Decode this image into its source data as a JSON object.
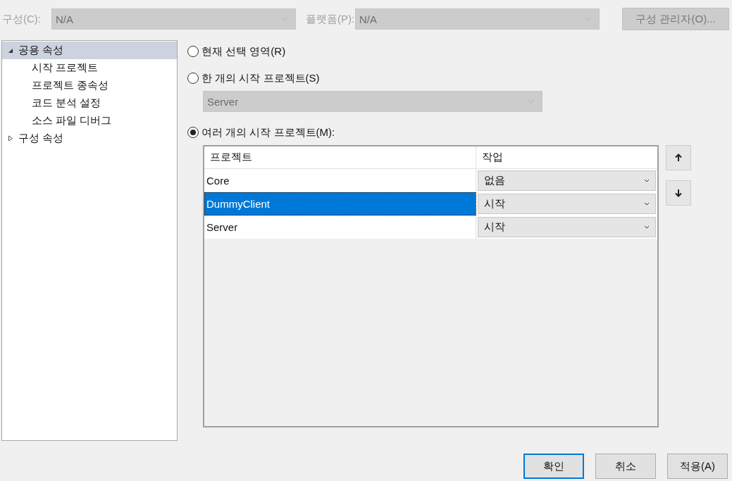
{
  "config_bar": {
    "configuration": {
      "label": "구성(C):",
      "value": "N/A",
      "disabled": true
    },
    "platform": {
      "label": "플랫폼(P):",
      "value": "N/A",
      "disabled": true
    },
    "manager_button": {
      "label": "구성 관리자(O)...",
      "disabled": true
    }
  },
  "tree": [
    {
      "label": "공용 속성",
      "expanded": true,
      "selected": true,
      "children": [
        {
          "label": "시작 프로젝트",
          "selected": false
        },
        {
          "label": "프로젝트 종속성",
          "selected": false
        },
        {
          "label": "코드 분석 설정",
          "selected": false
        },
        {
          "label": "소스 파일 디버그",
          "selected": false
        }
      ]
    },
    {
      "label": "구성 속성",
      "expanded": false,
      "selected": false
    }
  ],
  "options": [
    {
      "label": "현재 선택 영역(R)",
      "selected": false
    },
    {
      "label": "한 개의 시작 프로젝트(S)",
      "selected": false,
      "dropdown": {
        "value": "Server",
        "disabled": true
      }
    },
    {
      "label": "여러 개의 시작 프로젝트(M):",
      "selected": true
    }
  ],
  "grid": {
    "columns": [
      "프로젝트",
      "작업"
    ],
    "rows": [
      {
        "project": "Core",
        "action": "없음",
        "selected": false
      },
      {
        "project": "DummyClient",
        "action": "시작",
        "selected": true
      },
      {
        "project": "Server",
        "action": "시작",
        "selected": false
      }
    ]
  },
  "buttons": [
    {
      "label": "확인",
      "default": true
    },
    {
      "label": "취소",
      "default": false
    },
    {
      "label": "적용(A)",
      "default": false
    }
  ]
}
